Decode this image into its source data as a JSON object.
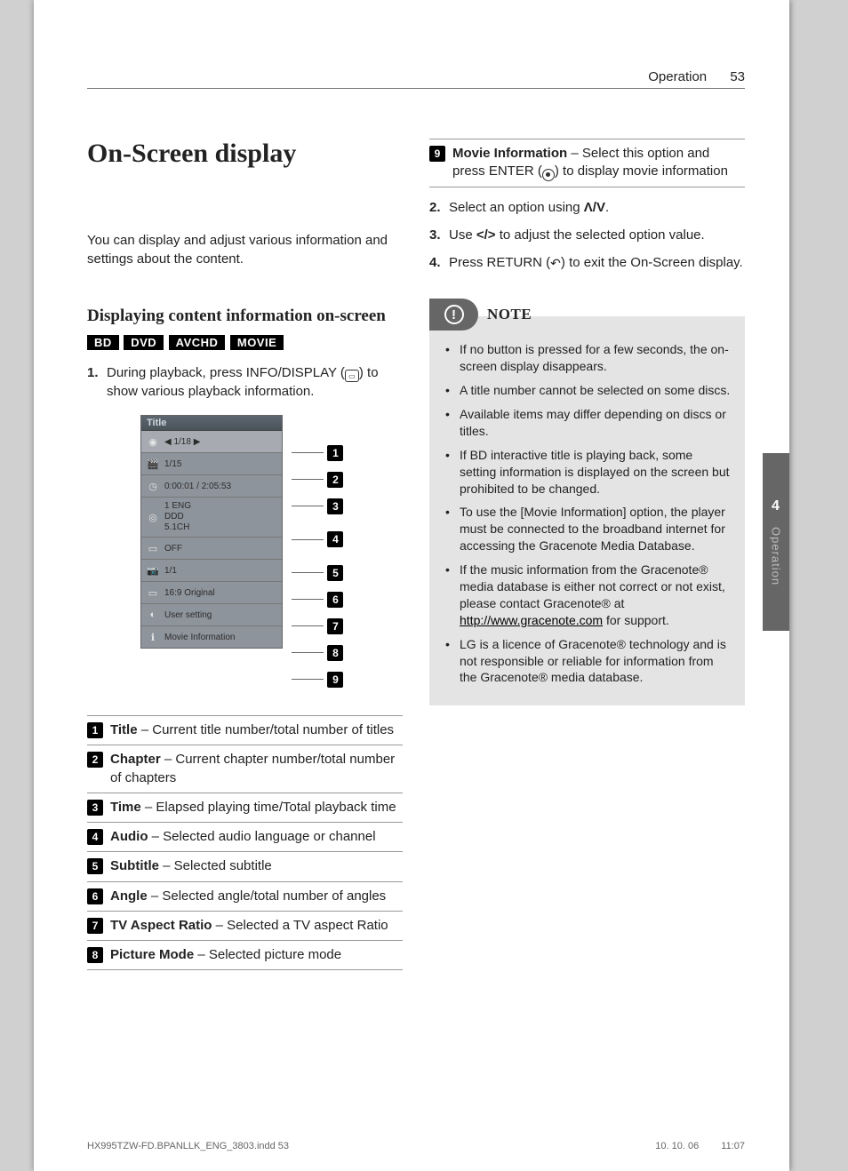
{
  "header": {
    "section": "Operation",
    "page_number": "53"
  },
  "main_title": "On-Screen display",
  "intro": "You can display and adjust various information and settings about the content.",
  "subsection_title": "Displaying content information on-screen",
  "badges": [
    "BD",
    "DVD",
    "AVCHD",
    "MOVIE"
  ],
  "step1": {
    "num": "1.",
    "text_pre": "During playback, press INFO/DISPLAY (",
    "text_post": ") to show various playback information."
  },
  "osd": {
    "title": "Title",
    "rows": [
      {
        "value": "◀ 1/18            ▶",
        "selected": true
      },
      {
        "value": "1/15"
      },
      {
        "value": "0:00:01 / 2:05:53"
      },
      {
        "value": "1 ENG\nDDD\n5.1CH",
        "tall": true
      },
      {
        "value": "OFF"
      },
      {
        "value": "1/1"
      },
      {
        "value": "16:9 Original"
      },
      {
        "value": "User setting"
      },
      {
        "value": "Movie Information"
      }
    ]
  },
  "legend": [
    {
      "n": "1",
      "term": "Title",
      "desc": " – Current title number/total number of titles"
    },
    {
      "n": "2",
      "term": "Chapter",
      "desc": " – Current chapter number/total number of chapters"
    },
    {
      "n": "3",
      "term": "Time",
      "desc": " – Elapsed playing time/Total playback time"
    },
    {
      "n": "4",
      "term": "Audio",
      "desc": " – Selected audio language or channel"
    },
    {
      "n": "5",
      "term": "Subtitle",
      "desc": " – Selected subtitle"
    },
    {
      "n": "6",
      "term": "Angle",
      "desc": " – Selected angle/total number of angles"
    },
    {
      "n": "7",
      "term": "TV Aspect Ratio",
      "desc": " – Selected a TV aspect Ratio"
    },
    {
      "n": "8",
      "term": "Picture Mode",
      "desc": " – Selected picture mode"
    }
  ],
  "legend9": {
    "n": "9",
    "term": "Movie Information",
    "desc_pre": " – Select this option and press ENTER (",
    "desc_post": ") to display movie information"
  },
  "steps_right": [
    {
      "num": "2.",
      "pre": "Select an option using ",
      "sym": "Λ/V",
      "post": "."
    },
    {
      "num": "3.",
      "pre": "Use ",
      "sym": "</>",
      "post": " to adjust the selected option value."
    },
    {
      "num": "4.",
      "pre": "Press RETURN (",
      "icon": "return",
      "post": ") to exit the On-Screen display."
    }
  ],
  "note": {
    "label": "NOTE",
    "items": [
      "If no button is pressed for a few seconds, the on-screen display disappears.",
      "A title number cannot be selected on some discs.",
      "Available items may differ depending on discs or titles.",
      "If BD interactive title is playing back, some setting information is displayed on the screen but prohibited to be changed.",
      "To use the [Movie Information] option, the player must be connected to the broadband internet for accessing the Gracenote Media Database."
    ],
    "item_link": {
      "pre": "If the music information from the Gracenote® media database is either not correct or not exist, please contact Gracenote® at ",
      "url": "http://www.gracenote.com",
      "post": " for support."
    },
    "item_last": "LG is a licence of Gracenote® technology and is not responsible or reliable for information from the Gracenote® media database."
  },
  "side_tab": {
    "chapter_no": "4",
    "label": "Operation"
  },
  "footer": {
    "left": "HX995TZW-FD.BPANLLK_ENG_3803.indd   53",
    "date": "10. 10. 06",
    "time": "11:07"
  }
}
